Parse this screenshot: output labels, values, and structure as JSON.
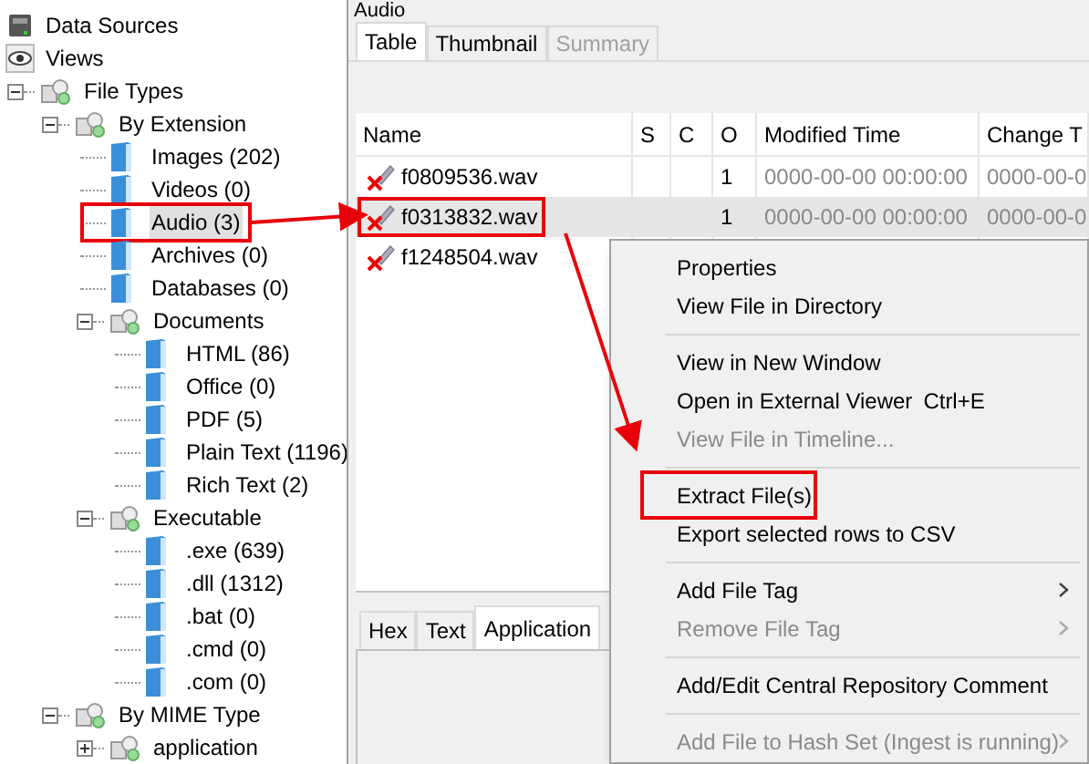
{
  "tree": [
    {
      "label": "Data Sources",
      "kind": "datasource",
      "selected": false
    },
    {
      "label": "Views",
      "kind": "views",
      "selected": false
    },
    {
      "label": "File Types",
      "kind": "group",
      "expanded": true,
      "selected": false,
      "children": [
        {
          "label": "By Extension",
          "kind": "group",
          "expanded": true,
          "selected": false,
          "children": [
            {
              "label": "Images (202)",
              "kind": "filetype",
              "selected": false
            },
            {
              "label": "Videos (0)",
              "kind": "filetype",
              "selected": false
            },
            {
              "label": "Audio (3)",
              "kind": "filetype",
              "selected": true,
              "annotated": true
            },
            {
              "label": "Archives (0)",
              "kind": "filetype",
              "selected": false
            },
            {
              "label": "Databases (0)",
              "kind": "filetype",
              "selected": false
            },
            {
              "label": "Documents",
              "kind": "group",
              "expanded": true,
              "selected": false,
              "children": [
                {
                  "label": "HTML (86)",
                  "kind": "filetype",
                  "selected": false
                },
                {
                  "label": "Office (0)",
                  "kind": "filetype",
                  "selected": false
                },
                {
                  "label": "PDF (5)",
                  "kind": "filetype",
                  "selected": false
                },
                {
                  "label": "Plain Text (1196)",
                  "kind": "filetype",
                  "selected": false
                },
                {
                  "label": "Rich Text (2)",
                  "kind": "filetype",
                  "selected": false
                }
              ]
            },
            {
              "label": "Executable",
              "kind": "group",
              "expanded": true,
              "selected": false,
              "children": [
                {
                  "label": ".exe (639)",
                  "kind": "filetype",
                  "selected": false
                },
                {
                  "label": ".dll (1312)",
                  "kind": "filetype",
                  "selected": false
                },
                {
                  "label": ".bat (0)",
                  "kind": "filetype",
                  "selected": false
                },
                {
                  "label": ".cmd (0)",
                  "kind": "filetype",
                  "selected": false
                },
                {
                  "label": ".com (0)",
                  "kind": "filetype",
                  "selected": false
                }
              ]
            }
          ]
        },
        {
          "label": "By MIME Type",
          "kind": "group",
          "expanded": true,
          "selected": false,
          "children": [
            {
              "label": "application",
              "kind": "group",
              "expanded": false,
              "selected": false
            }
          ]
        }
      ]
    }
  ],
  "panel": {
    "title": "Audio",
    "tabs": [
      {
        "label": "Table",
        "selected": true,
        "disabled": false
      },
      {
        "label": "Thumbnail",
        "selected": false,
        "disabled": false
      },
      {
        "label": "Summary",
        "selected": false,
        "disabled": true
      }
    ],
    "table": {
      "columns": [
        "Name",
        "S",
        "C",
        "O",
        "Modified Time",
        "Change T"
      ],
      "rows": [
        {
          "cells": [
            "f0809536.wav",
            "",
            "",
            "1",
            "0000-00-00 00:00:00",
            "0000-00-0"
          ],
          "selected": false,
          "annotated": false
        },
        {
          "cells": [
            "f0313832.wav",
            "",
            "",
            "1",
            "0000-00-00 00:00:00",
            "0000-00-0"
          ],
          "selected": true,
          "annotated": true
        },
        {
          "cells": [
            "f1248504.wav",
            "",
            "",
            "",
            "",
            ""
          ],
          "selected": false,
          "annotated": false
        }
      ]
    },
    "bottom_tabs": [
      {
        "label": "Hex",
        "selected": false
      },
      {
        "label": "Text",
        "selected": false
      },
      {
        "label": "Application",
        "selected": true
      }
    ]
  },
  "context_menu": [
    {
      "kind": "item",
      "label": "Properties",
      "disabled": false
    },
    {
      "kind": "item",
      "label": "View File in Directory",
      "disabled": false
    },
    {
      "kind": "separator"
    },
    {
      "kind": "item",
      "label": "View in New Window",
      "disabled": false
    },
    {
      "kind": "item",
      "label": "Open in External Viewer",
      "shortcut": "Ctrl+E",
      "disabled": false
    },
    {
      "kind": "item",
      "label": "View File in Timeline...",
      "disabled": true
    },
    {
      "kind": "separator"
    },
    {
      "kind": "item",
      "label": "Extract File(s)",
      "disabled": false,
      "annotated": true
    },
    {
      "kind": "item",
      "label": "Export selected rows to CSV",
      "disabled": false
    },
    {
      "kind": "separator"
    },
    {
      "kind": "submenu",
      "label": "Add File Tag",
      "disabled": false
    },
    {
      "kind": "submenu",
      "label": "Remove File Tag",
      "disabled": true
    },
    {
      "kind": "separator"
    },
    {
      "kind": "item",
      "label": "Add/Edit Central Repository Comment",
      "disabled": false
    },
    {
      "kind": "separator"
    },
    {
      "kind": "submenu",
      "label": "Add File to Hash Set (Ingest is running)",
      "disabled": true
    }
  ]
}
